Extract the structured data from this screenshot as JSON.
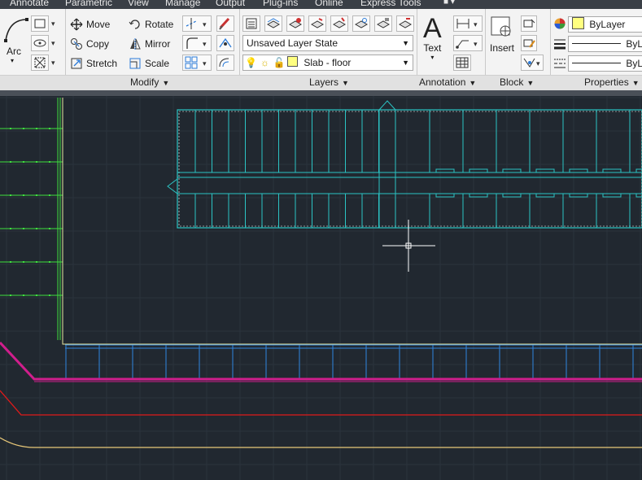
{
  "menu": {
    "tabs": [
      "Annotate",
      "Parametric",
      "View",
      "Manage",
      "Output",
      "Plug-ins",
      "Online",
      "Express Tools"
    ]
  },
  "draw_panel": {
    "arc_label": "Arc"
  },
  "modify_panel": {
    "title": "Modify",
    "move": "Move",
    "copy": "Copy",
    "stretch": "Stretch",
    "rotate": "Rotate",
    "mirror": "Mirror",
    "scale": "Scale"
  },
  "layers_panel": {
    "title": "Layers",
    "layer_state": "Unsaved Layer State",
    "current_layer": "Slab - floor",
    "layer_color": "#ffff80"
  },
  "annotation_panel": {
    "title": "Annotation",
    "text_label": "Text"
  },
  "block_panel": {
    "title": "Block",
    "insert_label": "Insert"
  },
  "properties_panel": {
    "title": "Properties",
    "color_value": "ByLayer",
    "linetype_value": "ByLa",
    "lineweight_value": "ByLa"
  },
  "colors": {
    "canvas_bg": "#212830",
    "cyan_geometry": "#2bc4c4",
    "blue_geometry": "#2f86e0",
    "green_geometry": "#3ee03e",
    "magenta_geometry": "#d01e8c",
    "red_geometry": "#e01a1a",
    "tan_geometry": "#e8c878"
  }
}
